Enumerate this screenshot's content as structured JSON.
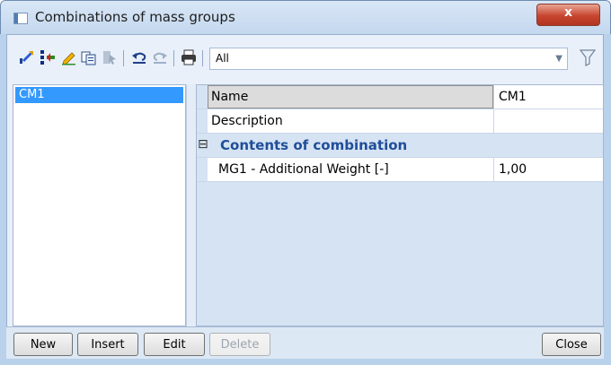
{
  "window": {
    "title": "Combinations of mass groups",
    "close_glyph": "x"
  },
  "toolbar": {
    "icons": [
      "select-icon",
      "insert-column-icon",
      "edit-pencil-icon",
      "copy-icon",
      "cursor-icon",
      "undo-icon",
      "redo-icon",
      "print-icon"
    ],
    "filter_value": "All",
    "filter_icon": "funnel-icon"
  },
  "list": {
    "items": [
      "CM1"
    ],
    "selected": "CM1",
    "selected_color": "#3399ff"
  },
  "properties": {
    "name_label": "Name",
    "name_value": "CM1",
    "description_label": "Description",
    "description_value": "",
    "group_toggle": "⊟",
    "group_label": "Contents of combination",
    "group_color": "#1f4e99",
    "rows": [
      {
        "label": "MG1 - Additional Weight [-]",
        "value": "1,00"
      }
    ]
  },
  "buttons": {
    "new": "New",
    "insert": "Insert",
    "edit": "Edit",
    "delete": "Delete",
    "close": "Close"
  }
}
